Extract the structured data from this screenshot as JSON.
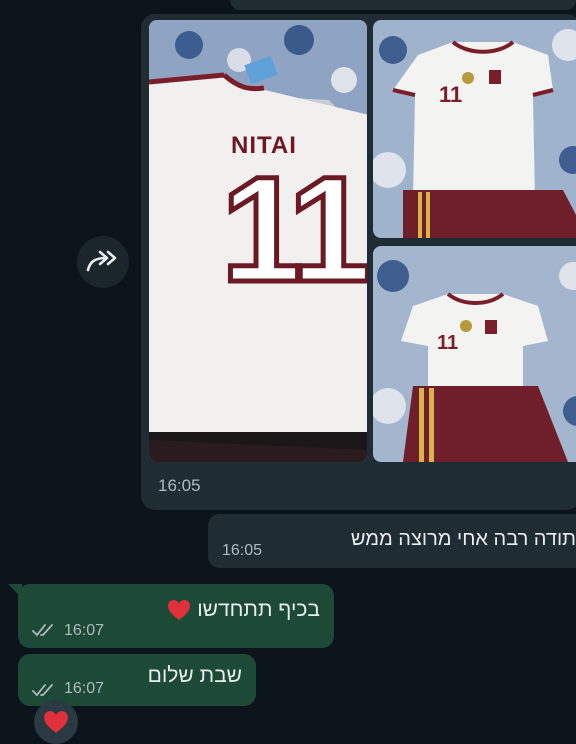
{
  "colors": {
    "background": "#0b141a",
    "incoming_bubble": "#1f2c34",
    "outgoing_bubble": "#1d4a36",
    "timestamp": "#aebac1",
    "heart": "#e0303b"
  },
  "album": {
    "photos": [
      {
        "name_on_shirt": "NITAI",
        "number": "11"
      },
      {
        "number": "11"
      },
      {
        "number": "11"
      }
    ],
    "time": "16:05",
    "forward_icon": "forward-arrow-icon"
  },
  "incoming_message": {
    "text": "תודה רבה אחי מרוצה ממש",
    "time": "16:05"
  },
  "outgoing_messages": [
    {
      "text": "בכיף תתחדשו",
      "emoji": "heart-icon",
      "time": "16:07",
      "status_icon": "double-check-icon"
    },
    {
      "text": "שבת שלום",
      "time": "16:07",
      "status_icon": "double-check-icon"
    }
  ],
  "reaction": {
    "emoji": "heart-icon"
  }
}
